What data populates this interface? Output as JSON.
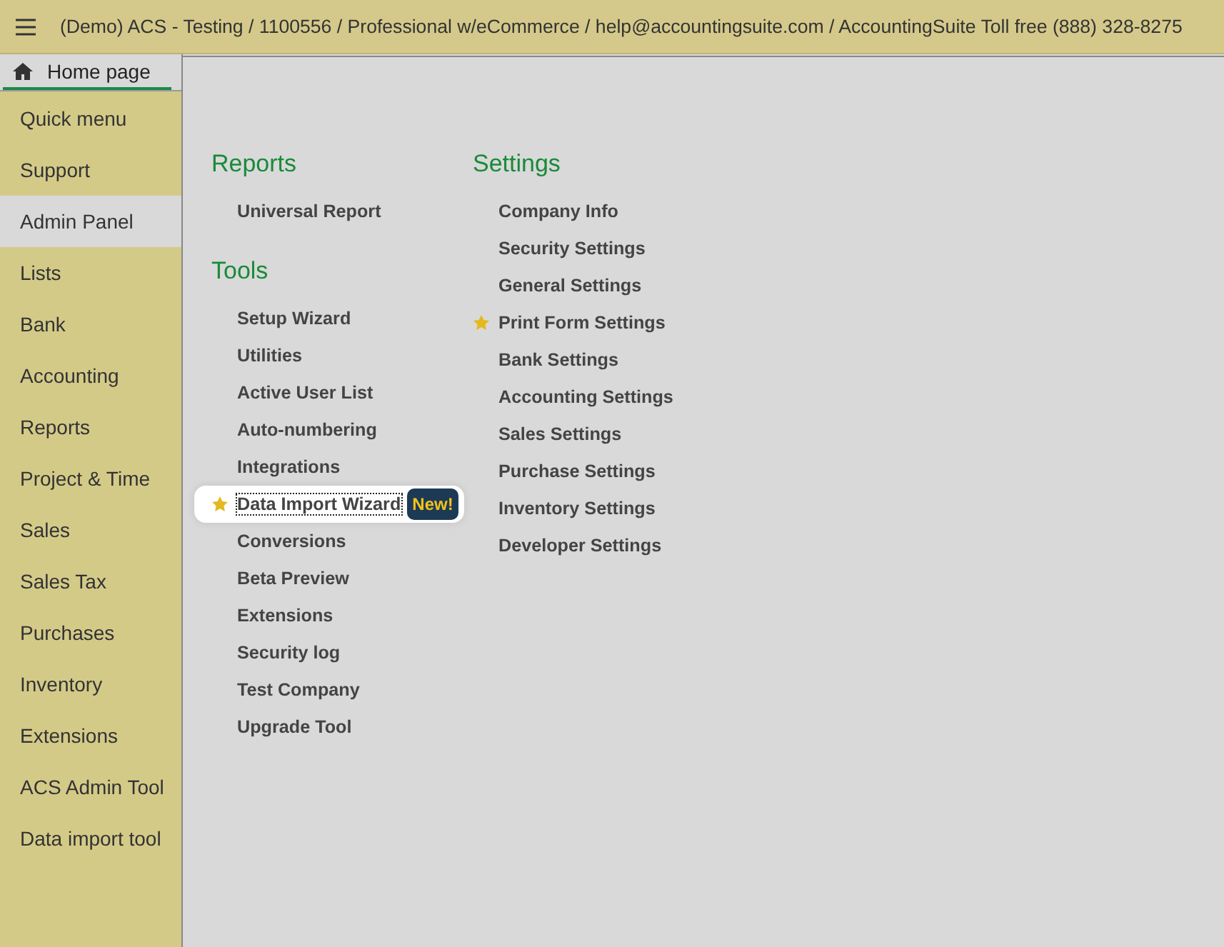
{
  "header": {
    "title": "(Demo) ACS - Testing / 1100556 / Professional w/eCommerce / help@accountingsuite.com / AccountingSuite Toll free (888) 328-8275"
  },
  "tabs": [
    {
      "label": "Home page",
      "selected": true
    }
  ],
  "sidebar": {
    "items": [
      {
        "label": "Quick menu",
        "selected": false
      },
      {
        "label": "Support",
        "selected": false
      },
      {
        "label": "Admin Panel",
        "selected": true
      },
      {
        "label": "Lists",
        "selected": false
      },
      {
        "label": "Bank",
        "selected": false
      },
      {
        "label": "Accounting",
        "selected": false
      },
      {
        "label": "Reports",
        "selected": false
      },
      {
        "label": "Project & Time",
        "selected": false
      },
      {
        "label": "Sales",
        "selected": false
      },
      {
        "label": "Sales Tax",
        "selected": false
      },
      {
        "label": "Purchases",
        "selected": false
      },
      {
        "label": "Inventory",
        "selected": false
      },
      {
        "label": "Extensions",
        "selected": false
      },
      {
        "label": "ACS Admin Tool",
        "selected": false
      },
      {
        "label": "Data import tool",
        "selected": false
      }
    ]
  },
  "columns": [
    {
      "sections": [
        {
          "title": "Reports",
          "items": [
            {
              "label": "Universal Report",
              "starred": false
            }
          ]
        },
        {
          "title": "Tools",
          "items": [
            {
              "label": "Setup Wizard",
              "starred": false
            },
            {
              "label": "Utilities",
              "starred": false
            },
            {
              "label": "Active User List",
              "starred": false
            },
            {
              "label": "Auto-numbering",
              "starred": false
            },
            {
              "label": "Integrations",
              "starred": false
            },
            {
              "label": "Data Import Wizard",
              "starred": true,
              "highlighted": true,
              "badge": "New!"
            },
            {
              "label": "Conversions",
              "starred": false
            },
            {
              "label": "Beta Preview",
              "starred": false
            },
            {
              "label": "Extensions",
              "starred": false
            },
            {
              "label": "Security log",
              "starred": false
            },
            {
              "label": "Test Company",
              "starred": false
            },
            {
              "label": "Upgrade Tool",
              "starred": false
            }
          ]
        }
      ]
    },
    {
      "sections": [
        {
          "title": "Settings",
          "items": [
            {
              "label": "Company Info",
              "starred": false
            },
            {
              "label": "Security Settings",
              "starred": false
            },
            {
              "label": "General Settings",
              "starred": false
            },
            {
              "label": "Print Form Settings",
              "starred": true
            },
            {
              "label": "Bank Settings",
              "starred": false
            },
            {
              "label": "Accounting Settings",
              "starred": false
            },
            {
              "label": "Sales Settings",
              "starred": false
            },
            {
              "label": "Purchase Settings",
              "starred": false
            },
            {
              "label": "Inventory Settings",
              "starred": false
            },
            {
              "label": "Developer Settings",
              "starred": false
            }
          ]
        }
      ]
    }
  ]
}
